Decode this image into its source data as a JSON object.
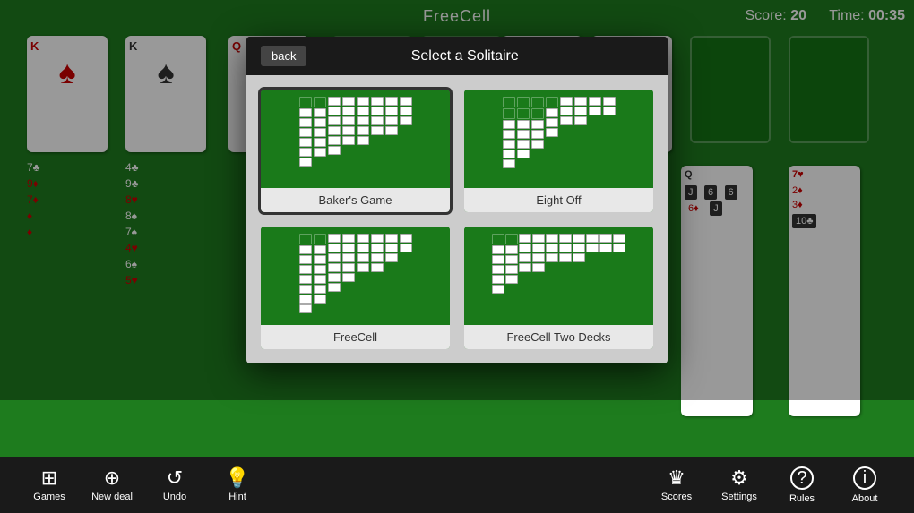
{
  "app": {
    "title": "FreeCell",
    "score_label": "Score:",
    "score_value": "20",
    "time_label": "Time:",
    "time_value": "00:35"
  },
  "modal": {
    "back_label": "back",
    "title": "Select a Solitaire",
    "options": [
      {
        "id": "bakers-game",
        "label": "Baker's Game",
        "selected": false
      },
      {
        "id": "eight-off",
        "label": "Eight Off",
        "selected": false
      },
      {
        "id": "freecell",
        "label": "FreeCell",
        "selected": true
      },
      {
        "id": "freecell-two-decks",
        "label": "FreeCell Two Decks",
        "selected": false
      }
    ]
  },
  "toolbar": {
    "left_items": [
      {
        "id": "games",
        "label": "Games",
        "icon": "⊞"
      },
      {
        "id": "new-deal",
        "label": "New deal",
        "icon": "⊕"
      },
      {
        "id": "undo",
        "label": "Undo",
        "icon": "↺"
      },
      {
        "id": "hint",
        "label": "Hint",
        "icon": "💡"
      }
    ],
    "right_items": [
      {
        "id": "scores",
        "label": "Scores",
        "icon": "♛"
      },
      {
        "id": "settings",
        "label": "Settings",
        "icon": "⚙"
      },
      {
        "id": "rules",
        "label": "Rules",
        "icon": "?"
      },
      {
        "id": "about",
        "label": "About",
        "icon": "ℹ"
      }
    ]
  }
}
